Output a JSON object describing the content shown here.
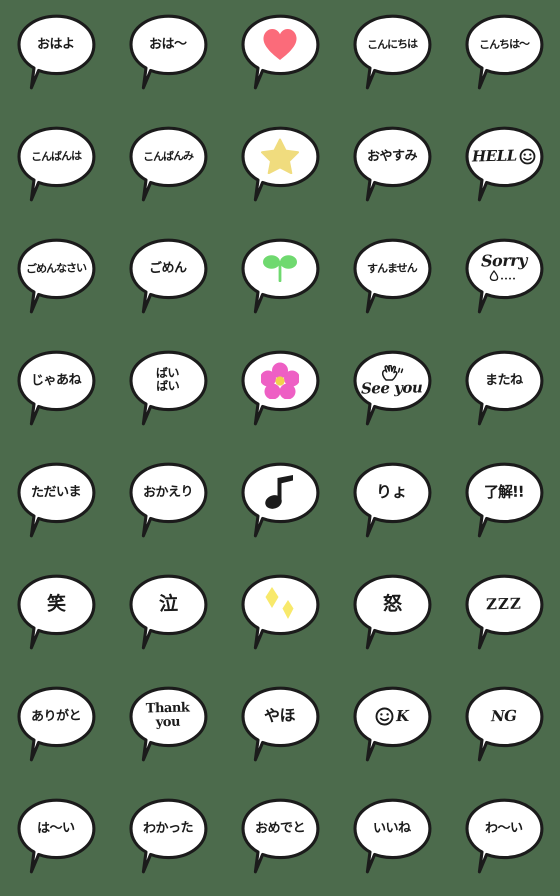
{
  "sheet": {
    "background_color": "#4c6b4c",
    "bubble_fill": "#ffffff",
    "bubble_outline": "#1b1b1b",
    "columns": 5,
    "rows": 8,
    "total_stickers": 40
  },
  "palette": {
    "heart_pink": "#fb6b7a",
    "star_yellow": "#f0dc7e",
    "sprout_green": "#6fd96f",
    "flower_pink": "#ee5fc4",
    "flower_center": "#f2d24b",
    "note_black": "#1b1b1b",
    "sparkle_yellow": "#f8e96b"
  },
  "stickers": [
    {
      "id": 1,
      "row": 1,
      "col": 1,
      "kind": "text",
      "text": "おはよ",
      "style": "t-jp"
    },
    {
      "id": 2,
      "row": 1,
      "col": 2,
      "kind": "text",
      "text": "おは〜",
      "style": "t-jp"
    },
    {
      "id": 3,
      "row": 1,
      "col": 3,
      "kind": "graphic",
      "icon": "heart-icon",
      "text": ""
    },
    {
      "id": 4,
      "row": 1,
      "col": 4,
      "kind": "text",
      "text": "こんにちは",
      "style": "t-jp-sm"
    },
    {
      "id": 5,
      "row": 1,
      "col": 5,
      "kind": "text",
      "text": "こんちは〜",
      "style": "t-jp-sm"
    },
    {
      "id": 6,
      "row": 2,
      "col": 1,
      "kind": "text",
      "text": "こんばんは",
      "style": "t-jp-sm"
    },
    {
      "id": 7,
      "row": 2,
      "col": 2,
      "kind": "text",
      "text": "こんばんみ",
      "style": "t-jp-sm"
    },
    {
      "id": 8,
      "row": 2,
      "col": 3,
      "kind": "graphic",
      "icon": "star-icon",
      "text": ""
    },
    {
      "id": 9,
      "row": 2,
      "col": 4,
      "kind": "text",
      "text": "おやすみ",
      "style": "t-jp"
    },
    {
      "id": 10,
      "row": 2,
      "col": 5,
      "kind": "graphic",
      "icon": "hello-smiley-icon",
      "text": "HELL"
    },
    {
      "id": 11,
      "row": 3,
      "col": 1,
      "kind": "text",
      "text": "ごめんなさい",
      "style": "t-jp-sm"
    },
    {
      "id": 12,
      "row": 3,
      "col": 2,
      "kind": "text",
      "text": "ごめん",
      "style": "t-jp"
    },
    {
      "id": 13,
      "row": 3,
      "col": 3,
      "kind": "graphic",
      "icon": "sprout-icon",
      "text": ""
    },
    {
      "id": 14,
      "row": 3,
      "col": 4,
      "kind": "text",
      "text": "すんません",
      "style": "t-jp-sm"
    },
    {
      "id": 15,
      "row": 3,
      "col": 5,
      "kind": "graphic",
      "icon": "sorry-teardrop-icon",
      "text": "Sorry"
    },
    {
      "id": 16,
      "row": 4,
      "col": 1,
      "kind": "text",
      "text": "じゃあね",
      "style": "t-jp"
    },
    {
      "id": 17,
      "row": 4,
      "col": 2,
      "kind": "text",
      "text": "ばい\nばい",
      "style": "t-two"
    },
    {
      "id": 18,
      "row": 4,
      "col": 3,
      "kind": "graphic",
      "icon": "flower-icon",
      "text": ""
    },
    {
      "id": 19,
      "row": 4,
      "col": 4,
      "kind": "graphic",
      "icon": "waving-hand-icon",
      "text": "See you"
    },
    {
      "id": 20,
      "row": 4,
      "col": 5,
      "kind": "text",
      "text": "またね",
      "style": "t-jp"
    },
    {
      "id": 21,
      "row": 5,
      "col": 1,
      "kind": "text",
      "text": "ただいま",
      "style": "t-jp"
    },
    {
      "id": 22,
      "row": 5,
      "col": 2,
      "kind": "text",
      "text": "おかえり",
      "style": "t-jp"
    },
    {
      "id": 23,
      "row": 5,
      "col": 3,
      "kind": "graphic",
      "icon": "music-note-icon",
      "text": ""
    },
    {
      "id": 24,
      "row": 5,
      "col": 4,
      "kind": "text",
      "text": "りょ",
      "style": "t-jp-lg"
    },
    {
      "id": 25,
      "row": 5,
      "col": 5,
      "kind": "text",
      "text": "了解!!",
      "style": "t-kanji2"
    },
    {
      "id": 26,
      "row": 6,
      "col": 1,
      "kind": "text",
      "text": "笑",
      "style": "t-kanji"
    },
    {
      "id": 27,
      "row": 6,
      "col": 2,
      "kind": "text",
      "text": "泣",
      "style": "t-kanji"
    },
    {
      "id": 28,
      "row": 6,
      "col": 3,
      "kind": "graphic",
      "icon": "sparkles-icon",
      "text": ""
    },
    {
      "id": 29,
      "row": 6,
      "col": 4,
      "kind": "text",
      "text": "怒",
      "style": "t-kanji"
    },
    {
      "id": 30,
      "row": 6,
      "col": 5,
      "kind": "text",
      "text": "ZZZ",
      "style": "t-zzz"
    },
    {
      "id": 31,
      "row": 7,
      "col": 1,
      "kind": "text",
      "text": "ありがと",
      "style": "t-jp"
    },
    {
      "id": 32,
      "row": 7,
      "col": 2,
      "kind": "text",
      "text": "Thank\nyou",
      "style": "t-lat-sm"
    },
    {
      "id": 33,
      "row": 7,
      "col": 3,
      "kind": "text",
      "text": "やほ",
      "style": "t-jp-lg"
    },
    {
      "id": 34,
      "row": 7,
      "col": 4,
      "kind": "graphic",
      "icon": "ok-smiley-icon",
      "text": "K"
    },
    {
      "id": 35,
      "row": 7,
      "col": 5,
      "kind": "text",
      "text": "NG",
      "style": "t-lat"
    },
    {
      "id": 36,
      "row": 8,
      "col": 1,
      "kind": "text",
      "text": "は〜い",
      "style": "t-jp"
    },
    {
      "id": 37,
      "row": 8,
      "col": 2,
      "kind": "text",
      "text": "わかった",
      "style": "t-jp"
    },
    {
      "id": 38,
      "row": 8,
      "col": 3,
      "kind": "text",
      "text": "おめでと",
      "style": "t-jp"
    },
    {
      "id": 39,
      "row": 8,
      "col": 4,
      "kind": "text",
      "text": "いいね",
      "style": "t-jp"
    },
    {
      "id": 40,
      "row": 8,
      "col": 5,
      "kind": "text",
      "text": "わ〜い",
      "style": "t-jp"
    }
  ]
}
